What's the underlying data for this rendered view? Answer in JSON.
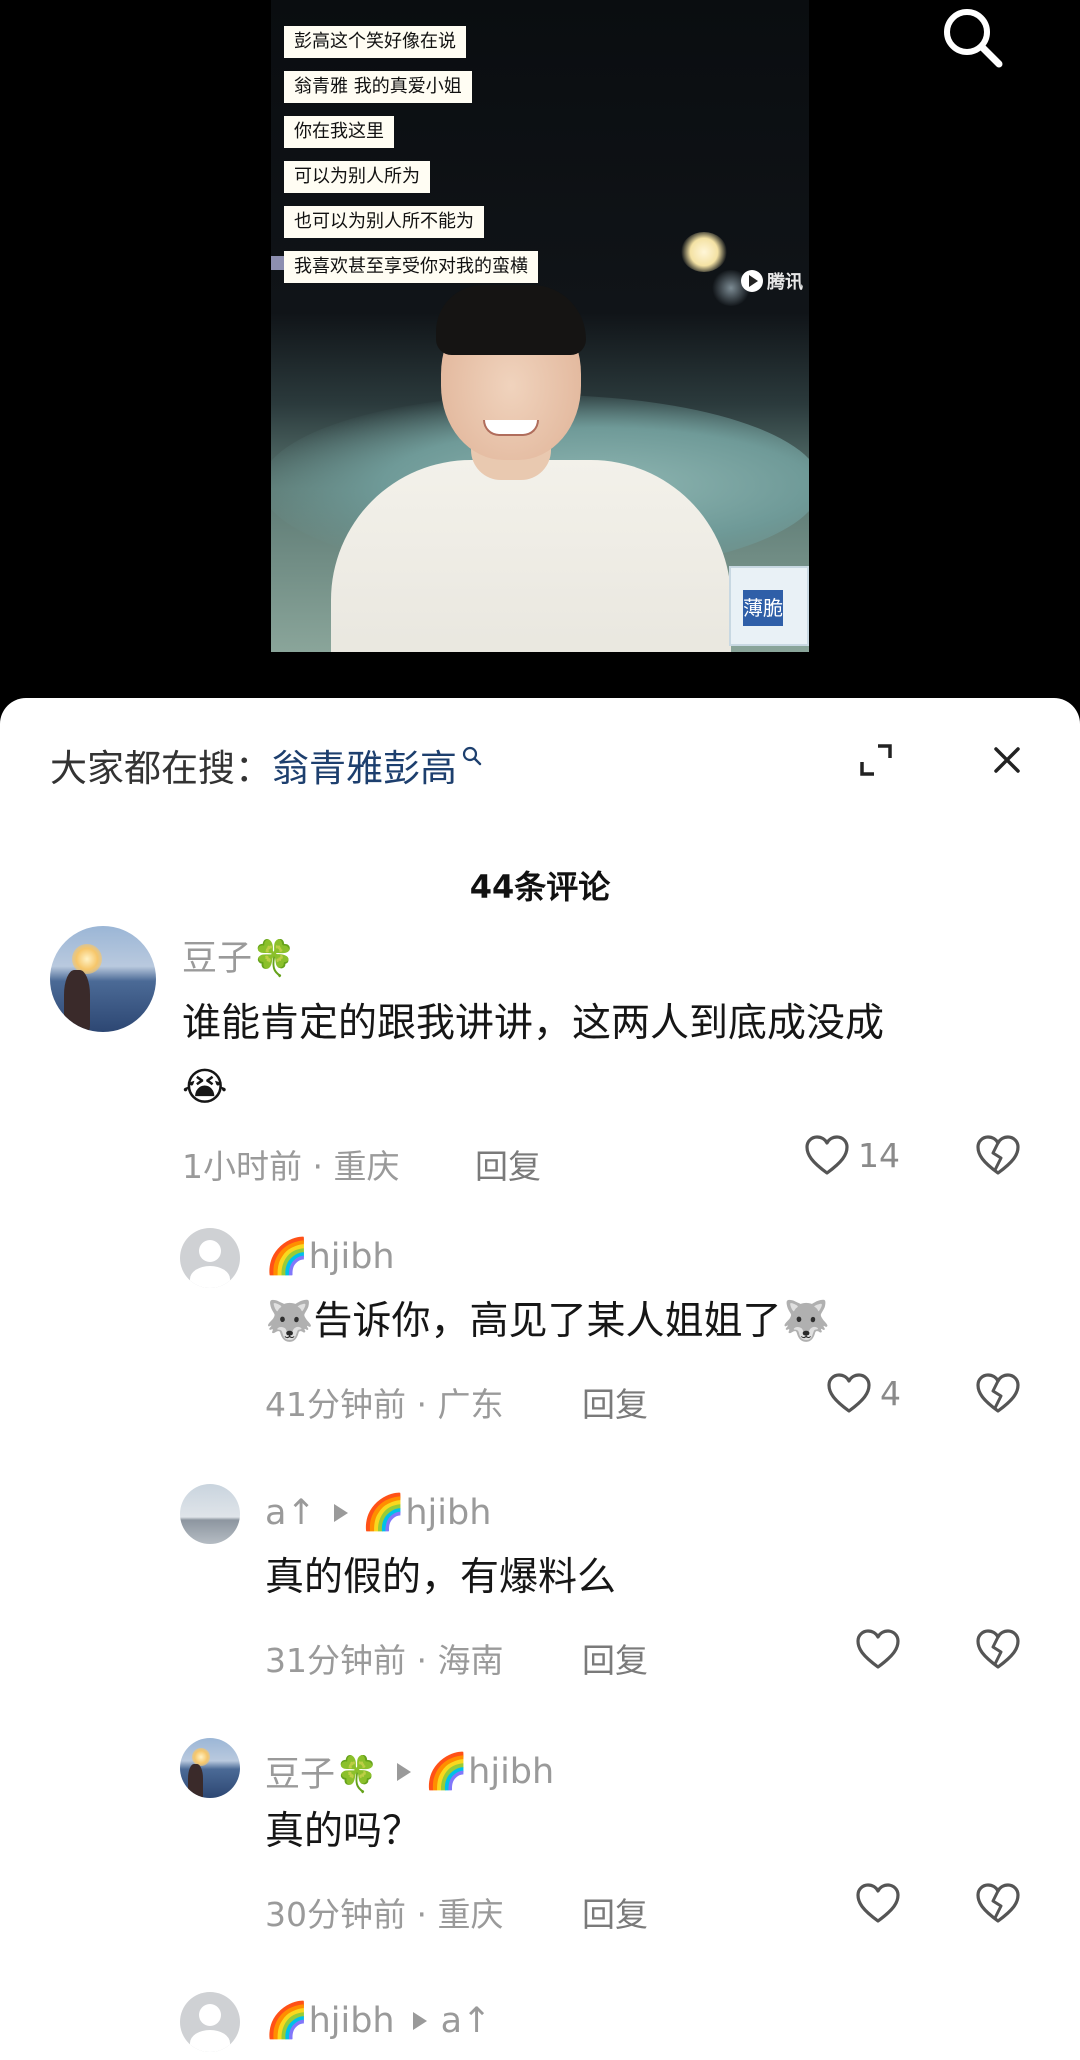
{
  "video": {
    "subtitles": [
      "彭高这个笑好像在说",
      "翁青雅 我的真爱小姐",
      "你在我这里",
      "可以为别人所为",
      "也可以为别人所不能为",
      "我喜欢甚至享受你对我的蛮横"
    ],
    "watermark": "腾讯",
    "product_label": "薄脆"
  },
  "sheet": {
    "search_prefix": "大家都在搜：",
    "search_term": "翁青雅彭高",
    "comment_count": "44条评论"
  },
  "comments": [
    {
      "user": "豆子🍀",
      "text_line1": "谁能肯定的跟我讲讲，这两人到底成没成",
      "text_line2": "😭",
      "meta": "1小时前 · 重庆",
      "reply_label": "回复",
      "likes": "14"
    },
    {
      "user": "🌈hjibh",
      "text": "🐺告诉你，高见了某人姐姐了🐺",
      "meta": "41分钟前 · 广东",
      "reply_label": "回复",
      "likes": "4"
    },
    {
      "user": "a↑",
      "reply_to": "🌈hjibh",
      "text": "真的假的，有爆料么",
      "meta": "31分钟前 · 海南",
      "reply_label": "回复",
      "likes": ""
    },
    {
      "user": "豆子🍀",
      "reply_to": "🌈hjibh",
      "text": "真的吗？",
      "meta": "30分钟前 · 重庆",
      "reply_label": "回复",
      "likes": ""
    },
    {
      "user": "🌈hjibh",
      "reply_to": "a↑"
    }
  ],
  "icons": {
    "search": "search-icon",
    "expand": "expand-icon",
    "close": "close-icon",
    "like": "heart-icon",
    "dislike": "broken-heart-icon"
  },
  "colors": {
    "search_term": "#1d3f6e",
    "meta_gray": "#9a9a9a",
    "text": "#161616"
  }
}
